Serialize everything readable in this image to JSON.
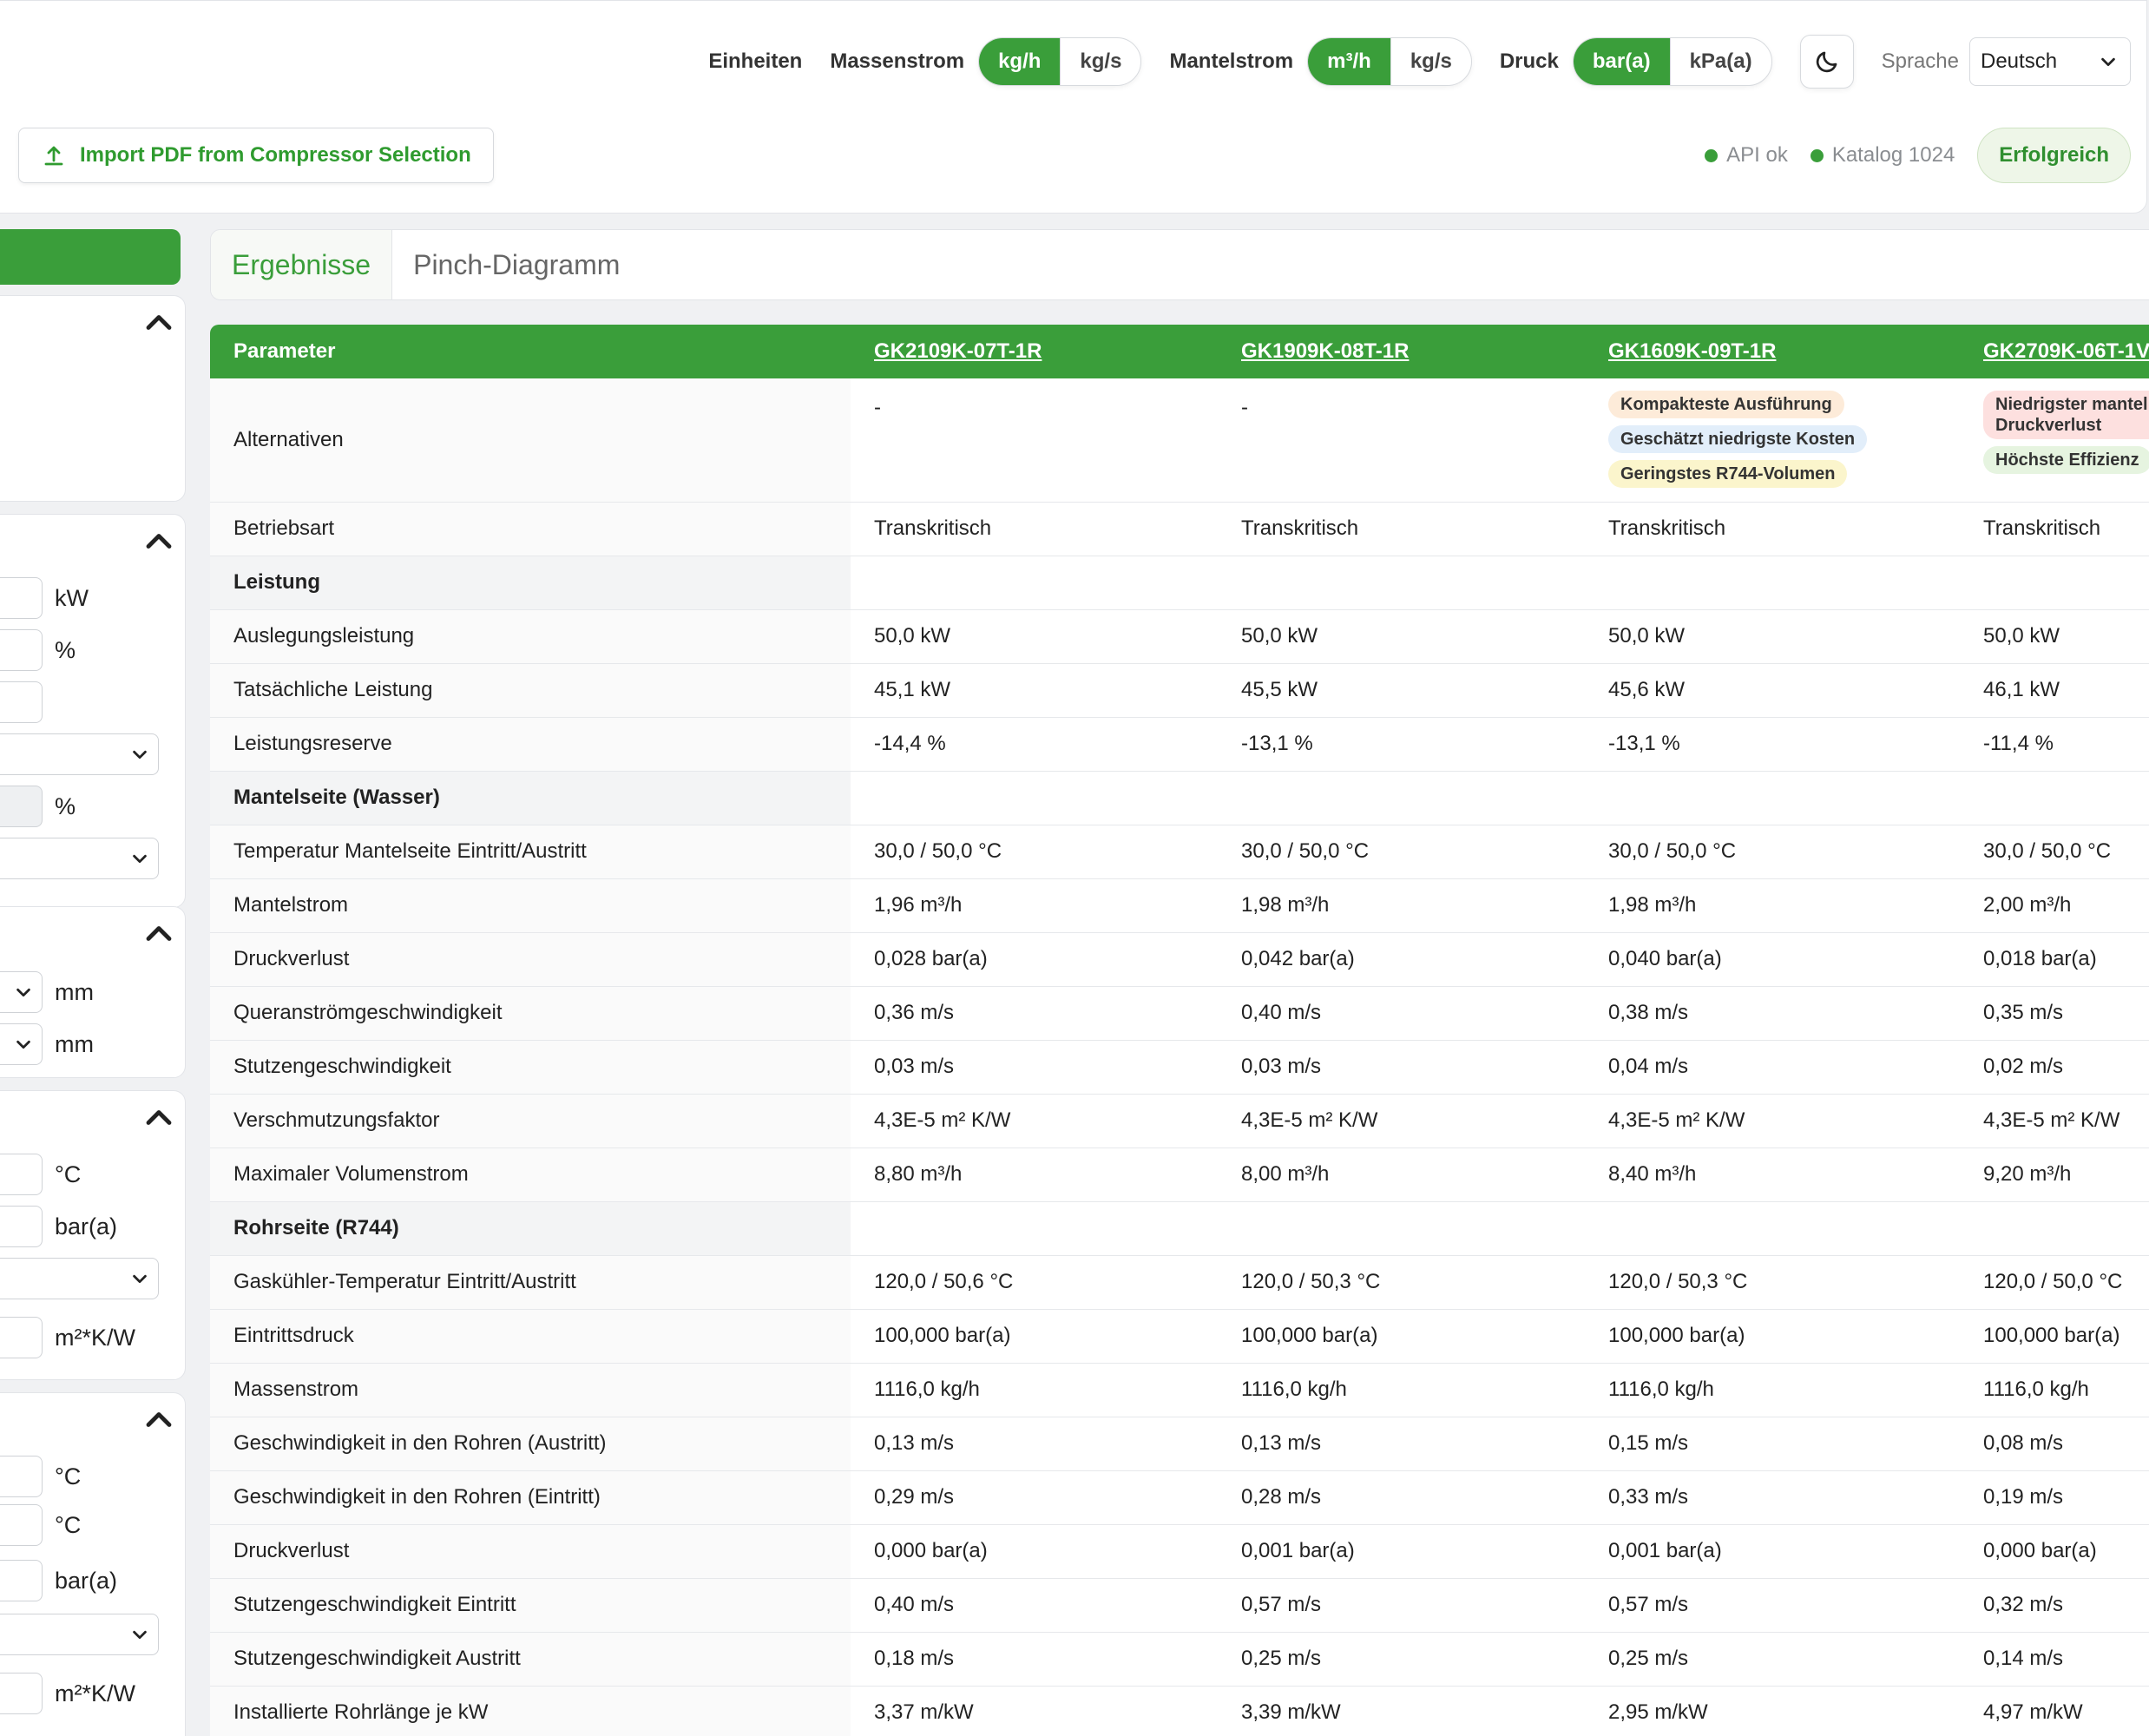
{
  "header": {
    "units_label": "Einheiten",
    "mass_flow": {
      "label": "Massenstrom",
      "options": [
        "kg/h",
        "kg/s"
      ],
      "active": "kg/h"
    },
    "shell_flow": {
      "label": "Mantelstrom",
      "options": [
        "m³/h",
        "kg/s"
      ],
      "active": "m³/h"
    },
    "pressure": {
      "label": "Druck",
      "options": [
        "bar(a)",
        "kPa(a)"
      ],
      "active": "bar(a)"
    },
    "theme_toggle_icon": "moon-icon",
    "language": {
      "label": "Sprache",
      "value": "Deutsch"
    },
    "import_button": "Import PDF from Compressor Selection",
    "status": {
      "api": "API ok",
      "catalog": "Katalog 1024",
      "result": "Erfolgreich"
    }
  },
  "sidebar": {
    "units": [
      "kW",
      "%",
      "%",
      "mm",
      "mm",
      "°C",
      "bar(a)",
      "m²*K/W",
      "°C",
      "°C",
      "bar(a)",
      "m²*K/W"
    ]
  },
  "tabs": [
    "Ergebnisse",
    "Pinch-Diagramm"
  ],
  "table": {
    "header": [
      "Parameter",
      "GK2109K-07T-1R",
      "GK1909K-08T-1R",
      "GK1609K-09T-1R",
      "GK2709K-06T-1V"
    ],
    "alternatives": {
      "label": "Alternativen",
      "values": [
        "-",
        "-"
      ],
      "badges_col3": [
        "Kompakteste Ausführung",
        "Geschätzt niedrigste Kosten",
        "Geringstes R744-Volumen"
      ],
      "badges_col4": [
        "Niedrigster mantel Druckverlust",
        "Höchste Effizienz"
      ]
    },
    "rows": [
      {
        "label": "Betriebsart",
        "values": [
          "Transkritisch",
          "Transkritisch",
          "Transkritisch",
          "Transkritisch"
        ]
      },
      {
        "section": "Leistung"
      },
      {
        "label": "Auslegungsleistung",
        "values": [
          "50,0 kW",
          "50,0 kW",
          "50,0 kW",
          "50,0 kW"
        ]
      },
      {
        "label": "Tatsächliche Leistung",
        "values": [
          "45,1 kW",
          "45,5 kW",
          "45,6 kW",
          "46,1 kW"
        ]
      },
      {
        "label": "Leistungsreserve",
        "values": [
          "-14,4 %",
          "-13,1 %",
          "-13,1 %",
          "-11,4 %"
        ]
      },
      {
        "section": "Mantelseite (Wasser)"
      },
      {
        "label": "Temperatur Mantelseite Eintritt/Austritt",
        "values": [
          "30,0 / 50,0 °C",
          "30,0 / 50,0 °C",
          "30,0 / 50,0 °C",
          "30,0 / 50,0 °C"
        ]
      },
      {
        "label": "Mantelstrom",
        "values": [
          "1,96 m³/h",
          "1,98 m³/h",
          "1,98 m³/h",
          "2,00 m³/h"
        ]
      },
      {
        "label": "Druckverlust",
        "values": [
          "0,028 bar(a)",
          "0,042 bar(a)",
          "0,040 bar(a)",
          "0,018 bar(a)"
        ]
      },
      {
        "label": "Queranströmgeschwindigkeit",
        "values": [
          "0,36 m/s",
          "0,40 m/s",
          "0,38 m/s",
          "0,35 m/s"
        ]
      },
      {
        "label": "Stutzengeschwindigkeit",
        "values": [
          "0,03 m/s",
          "0,03 m/s",
          "0,04 m/s",
          "0,02 m/s"
        ]
      },
      {
        "label": "Verschmutzungsfaktor",
        "values": [
          "4,3E-5 m² K/W",
          "4,3E-5 m² K/W",
          "4,3E-5 m² K/W",
          "4,3E-5 m² K/W"
        ]
      },
      {
        "label": "Maximaler Volumenstrom",
        "values": [
          "8,80 m³/h",
          "8,00 m³/h",
          "8,40 m³/h",
          "9,20 m³/h"
        ]
      },
      {
        "section": "Rohrseite (R744)"
      },
      {
        "label": "Gaskühler-Temperatur Eintritt/Austritt",
        "values": [
          "120,0 / 50,6 °C",
          "120,0 / 50,3 °C",
          "120,0 / 50,3 °C",
          "120,0 / 50,0 °C"
        ]
      },
      {
        "label": "Eintrittsdruck",
        "values": [
          "100,000 bar(a)",
          "100,000 bar(a)",
          "100,000 bar(a)",
          "100,000 bar(a)"
        ]
      },
      {
        "label": "Massenstrom",
        "values": [
          "1116,0 kg/h",
          "1116,0 kg/h",
          "1116,0 kg/h",
          "1116,0 kg/h"
        ]
      },
      {
        "label": "Geschwindigkeit in den Rohren (Austritt)",
        "values": [
          "0,13 m/s",
          "0,13 m/s",
          "0,15 m/s",
          "0,08 m/s"
        ]
      },
      {
        "label": "Geschwindigkeit in den Rohren (Eintritt)",
        "values": [
          "0,29 m/s",
          "0,28 m/s",
          "0,33 m/s",
          "0,19 m/s"
        ]
      },
      {
        "label": "Druckverlust",
        "values": [
          "0,000 bar(a)",
          "0,001 bar(a)",
          "0,001 bar(a)",
          "0,000 bar(a)"
        ]
      },
      {
        "label": "Stutzengeschwindigkeit Eintritt",
        "values": [
          "0,40 m/s",
          "0,57 m/s",
          "0,57 m/s",
          "0,32 m/s"
        ]
      },
      {
        "label": "Stutzengeschwindigkeit Austritt",
        "values": [
          "0,18 m/s",
          "0,25 m/s",
          "0,25 m/s",
          "0,14 m/s"
        ]
      },
      {
        "label": "Installierte Rohrlänge je kW",
        "values": [
          "3,37 m/kW",
          "3,39 m/kW",
          "2,95 m/kW",
          "4,97 m/kW"
        ]
      }
    ]
  },
  "colors": {
    "accent": "#3a9e3a",
    "badge_orange": "#fdebd9",
    "badge_blue": "#e2eefa",
    "badge_yellow": "#fbf5cc",
    "badge_pink": "#fde0df",
    "badge_green": "#e6f4e0"
  }
}
